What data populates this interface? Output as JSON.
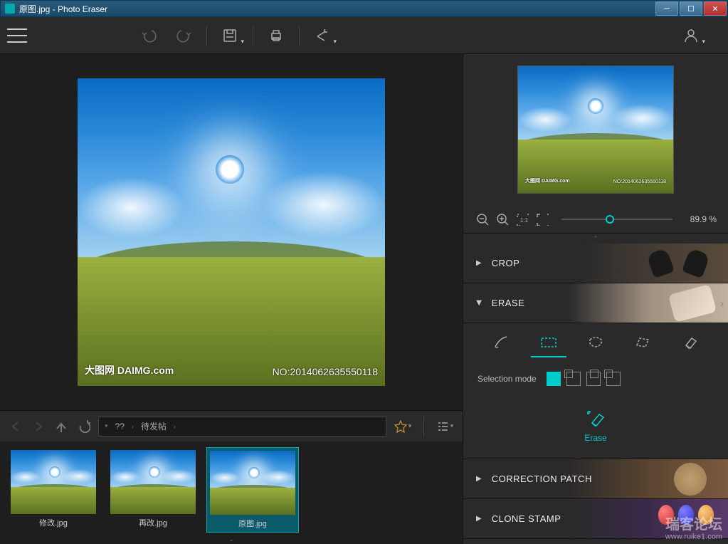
{
  "titlebar": {
    "filename": "原图.jpg",
    "appname": "Photo Eraser",
    "full": "原图.jpg - Photo Eraser"
  },
  "image": {
    "watermark_left": "大图网 DAIMG.com",
    "watermark_right": "NO:2014062635550118"
  },
  "breadcrumb": {
    "seg1": "??",
    "seg2": "待发帖"
  },
  "thumbnails": [
    {
      "label": "修改.jpg",
      "selected": false
    },
    {
      "label": "再改.jpg",
      "selected": false
    },
    {
      "label": "原图.jpg",
      "selected": true
    }
  ],
  "zoom": {
    "value": "89.9 %"
  },
  "panels": {
    "crop": "CROP",
    "erase": "ERASE",
    "patch": "CORRECTION PATCH",
    "clone": "CLONE STAMP"
  },
  "erase": {
    "selection_mode_label": "Selection mode",
    "action_label": "Erase"
  },
  "corner": {
    "main": "瑞客论坛",
    "sub": "www.ruike1.com"
  }
}
